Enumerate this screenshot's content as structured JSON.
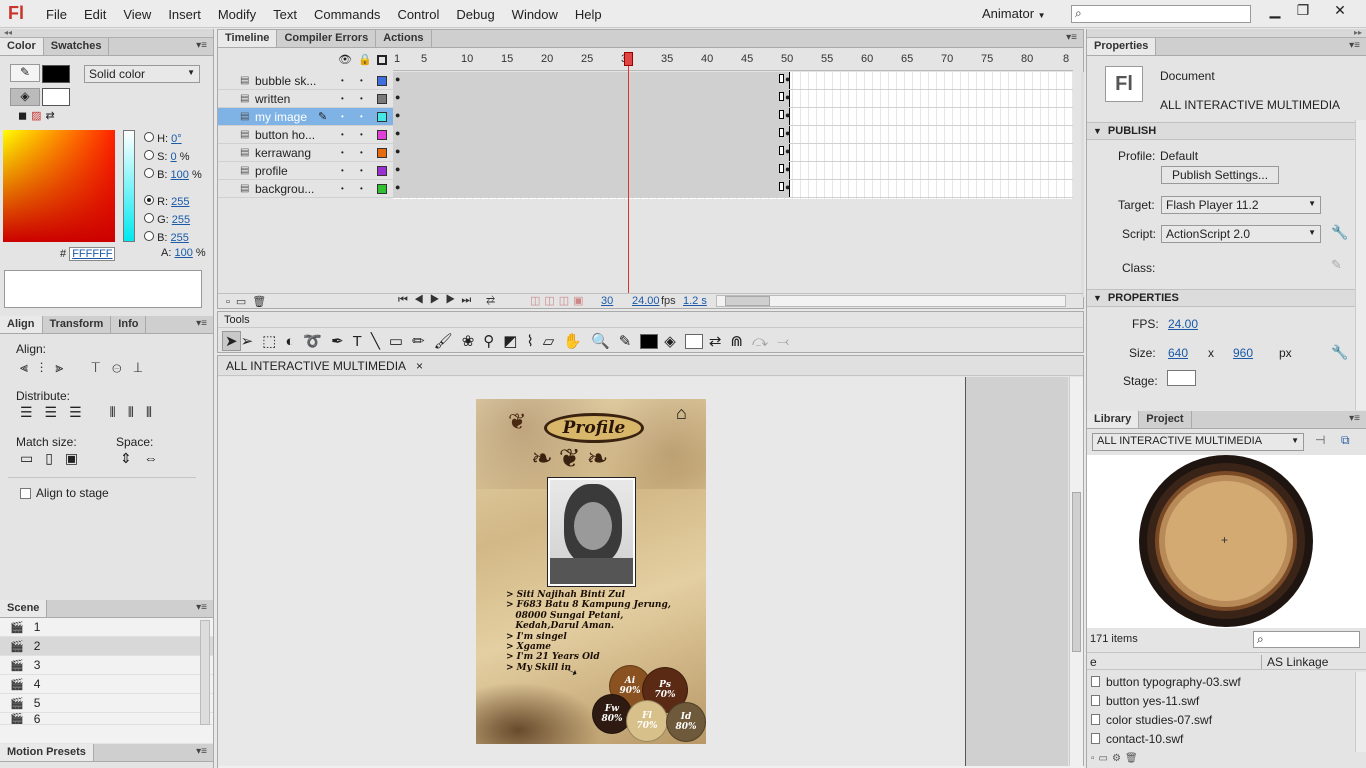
{
  "app": {
    "logo": "Fl",
    "workspace": "Animator",
    "menu": [
      "File",
      "Edit",
      "View",
      "Insert",
      "Modify",
      "Text",
      "Commands",
      "Control",
      "Debug",
      "Window",
      "Help"
    ]
  },
  "color_panel": {
    "tabs": [
      "Color",
      "Swatches"
    ],
    "fill_type": "Solid color",
    "hsb": {
      "h_label": "H:",
      "h": "0",
      "h_unit": "°",
      "s_label": "S:",
      "s": "0",
      "s_unit": "%",
      "b_label": "B:",
      "b": "100",
      "b_unit": "%"
    },
    "rgb": {
      "r_label": "R:",
      "r": "255",
      "g_label": "G:",
      "g": "255",
      "b_label": "B:",
      "b": "255"
    },
    "hex_label": "#",
    "hex": "FFFFFF",
    "alpha_label": "A:",
    "alpha": "100",
    "alpha_unit": "%"
  },
  "align_panel": {
    "tabs": [
      "Align",
      "Transform",
      "Info"
    ],
    "align_label": "Align:",
    "distribute_label": "Distribute:",
    "match_size_label": "Match size:",
    "space_label": "Space:",
    "align_to_stage": "Align to stage"
  },
  "scene_panel": {
    "title": "Scene",
    "scenes": [
      "1",
      "2",
      "3",
      "4",
      "5",
      "6"
    ],
    "selected": "2"
  },
  "motion_presets": {
    "title": "Motion Presets"
  },
  "timeline": {
    "tabs": [
      "Timeline",
      "Compiler Errors",
      "Actions"
    ],
    "frame_numbers": [
      "1",
      "5",
      "10",
      "15",
      "20",
      "25",
      "30",
      "35",
      "40",
      "45",
      "50",
      "55",
      "60",
      "65",
      "70",
      "75",
      "80",
      "8"
    ],
    "layers": [
      {
        "name": "bubble sk...",
        "color": "#3f6fdc"
      },
      {
        "name": "written",
        "color": "#7a7a7a"
      },
      {
        "name": "my image",
        "color": "#44e6e6"
      },
      {
        "name": "button ho...",
        "color": "#e040d8"
      },
      {
        "name": "kerrawang",
        "color": "#e86a10"
      },
      {
        "name": "profile",
        "color": "#9a30d0"
      },
      {
        "name": "backgrou...",
        "color": "#30c030"
      }
    ],
    "selected_layer": "my image",
    "current_frame": "30",
    "fps": "24.00",
    "fps_unit": "fps",
    "time": "1.2 s"
  },
  "tools": {
    "title": "Tools"
  },
  "document": {
    "tab": "ALL INTERACTIVE MULTIMEDIA",
    "close": "×"
  },
  "stage": {
    "title": "Profile",
    "bio": [
      "> Siti Najihah Binti Zul",
      "> F683 Batu 8 Kampung Jerung,",
      "   08000 Sungai Petani,",
      "   Kedah,Darul Aman.",
      "> I'm singel",
      "> Xgame",
      "> I'm 21 Years Old",
      "> My Skill in"
    ],
    "skills": [
      {
        "label": "Ai",
        "pct": "90%",
        "color": "#8a5220"
      },
      {
        "label": "Ps",
        "pct": "70%",
        "color": "#5a2a14"
      },
      {
        "label": "Fw",
        "pct": "80%",
        "color": "#2e1a10"
      },
      {
        "label": "Fl",
        "pct": "70%",
        "color": "#d8c08a"
      },
      {
        "label": "Id",
        "pct": "80%",
        "color": "#6e5a3a"
      }
    ]
  },
  "properties": {
    "tabs": [
      "Properties"
    ],
    "type": "Document",
    "name": "ALL INTERACTIVE MULTIMEDIA",
    "publish_head": "PUBLISH",
    "profile_label": "Profile:",
    "profile": "Default",
    "publish_settings": "Publish Settings...",
    "target_label": "Target:",
    "target": "Flash Player 11.2",
    "script_label": "Script:",
    "script": "ActionScript 2.0",
    "class_label": "Class:",
    "properties_head": "PROPERTIES",
    "fps_label": "FPS:",
    "fps": "24.00",
    "size_label": "Size:",
    "width": "640",
    "x": "x",
    "height": "960",
    "unit": "px",
    "stage_label": "Stage:"
  },
  "library": {
    "tabs": [
      "Library",
      "Project"
    ],
    "doc": "ALL INTERACTIVE MULTIMEDIA",
    "count": "171 items",
    "col_name": "e",
    "col_linkage": "AS Linkage",
    "items": [
      "button typography-03.swf",
      "button yes-11.swf",
      "color studies-07.swf",
      "contact-10.swf"
    ]
  }
}
